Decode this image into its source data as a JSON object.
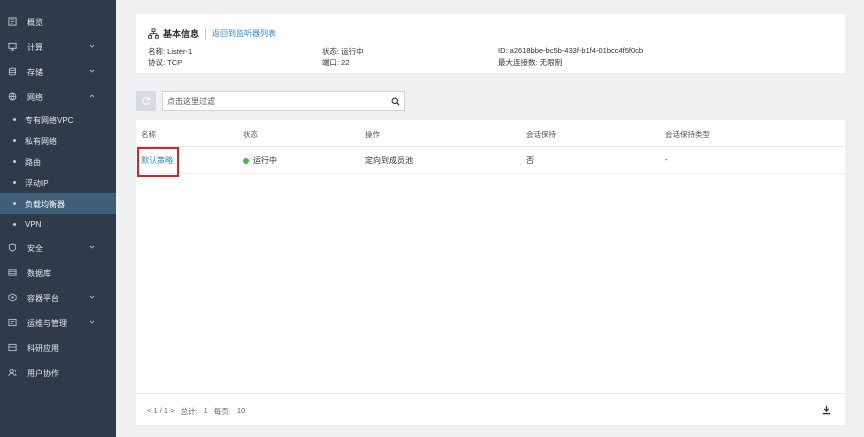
{
  "sidebar": {
    "items": [
      {
        "label": "概览",
        "icon": "overview-icon",
        "has_children": false
      },
      {
        "label": "计算",
        "icon": "compute-icon",
        "has_children": true,
        "expanded": false
      },
      {
        "label": "存储",
        "icon": "storage-icon",
        "has_children": true,
        "expanded": false
      },
      {
        "label": "网络",
        "icon": "network-icon",
        "has_children": true,
        "expanded": true
      }
    ],
    "network_children": [
      {
        "label": "专有网络VPC",
        "active": false
      },
      {
        "label": "私有网络",
        "active": false
      },
      {
        "label": "路由",
        "active": false
      },
      {
        "label": "浮动IP",
        "active": false
      },
      {
        "label": "负载均衡器",
        "active": true
      },
      {
        "label": "VPN",
        "active": false
      }
    ],
    "items_after": [
      {
        "label": "安全",
        "icon": "security-icon",
        "has_children": true
      },
      {
        "label": "数据库",
        "icon": "database-icon",
        "has_children": false
      },
      {
        "label": "容器平台",
        "icon": "container-icon",
        "has_children": true
      },
      {
        "label": "运维与管理",
        "icon": "ops-icon",
        "has_children": true
      },
      {
        "label": "科研应用",
        "icon": "research-icon",
        "has_children": false
      },
      {
        "label": "用户协作",
        "icon": "users-icon",
        "has_children": false
      }
    ]
  },
  "info": {
    "title": "基本信息",
    "back_link": "返回到监听器列表",
    "name_label": "名称: ",
    "name_value": "Lister-1",
    "protocol_label": "协议: ",
    "protocol_value": "TCP",
    "status_label": "状态: ",
    "status_value": "运行中",
    "port_label": "端口: ",
    "port_value": "22",
    "id_label": "ID: ",
    "id_value": "a2618bbe-bc5b-433f-b1f4-01bcc4f5f0cb",
    "maxconn_label": "最大连接数: ",
    "maxconn_value": "无限制"
  },
  "toolbar": {
    "search_placeholder": "点击这里过滤"
  },
  "table": {
    "columns": [
      "名称",
      "状态",
      "操作",
      "会话保持",
      "会话保持类型"
    ],
    "rows": [
      {
        "name": "默认策略",
        "status": "运行中",
        "action": "定向到成员池",
        "session": "否",
        "session_type": "-"
      }
    ]
  },
  "pager": {
    "range": "< 1 / 1 >",
    "total_label": "总计:",
    "total_value": "1",
    "per_page_label": "每页:",
    "per_page_value": "10"
  },
  "colors": {
    "sidebar_bg": "#2f3b48",
    "active_bg": "#3f5e78",
    "link": "#2d8ad6",
    "status_green": "#45b649",
    "highlight_red": "#e02020"
  }
}
